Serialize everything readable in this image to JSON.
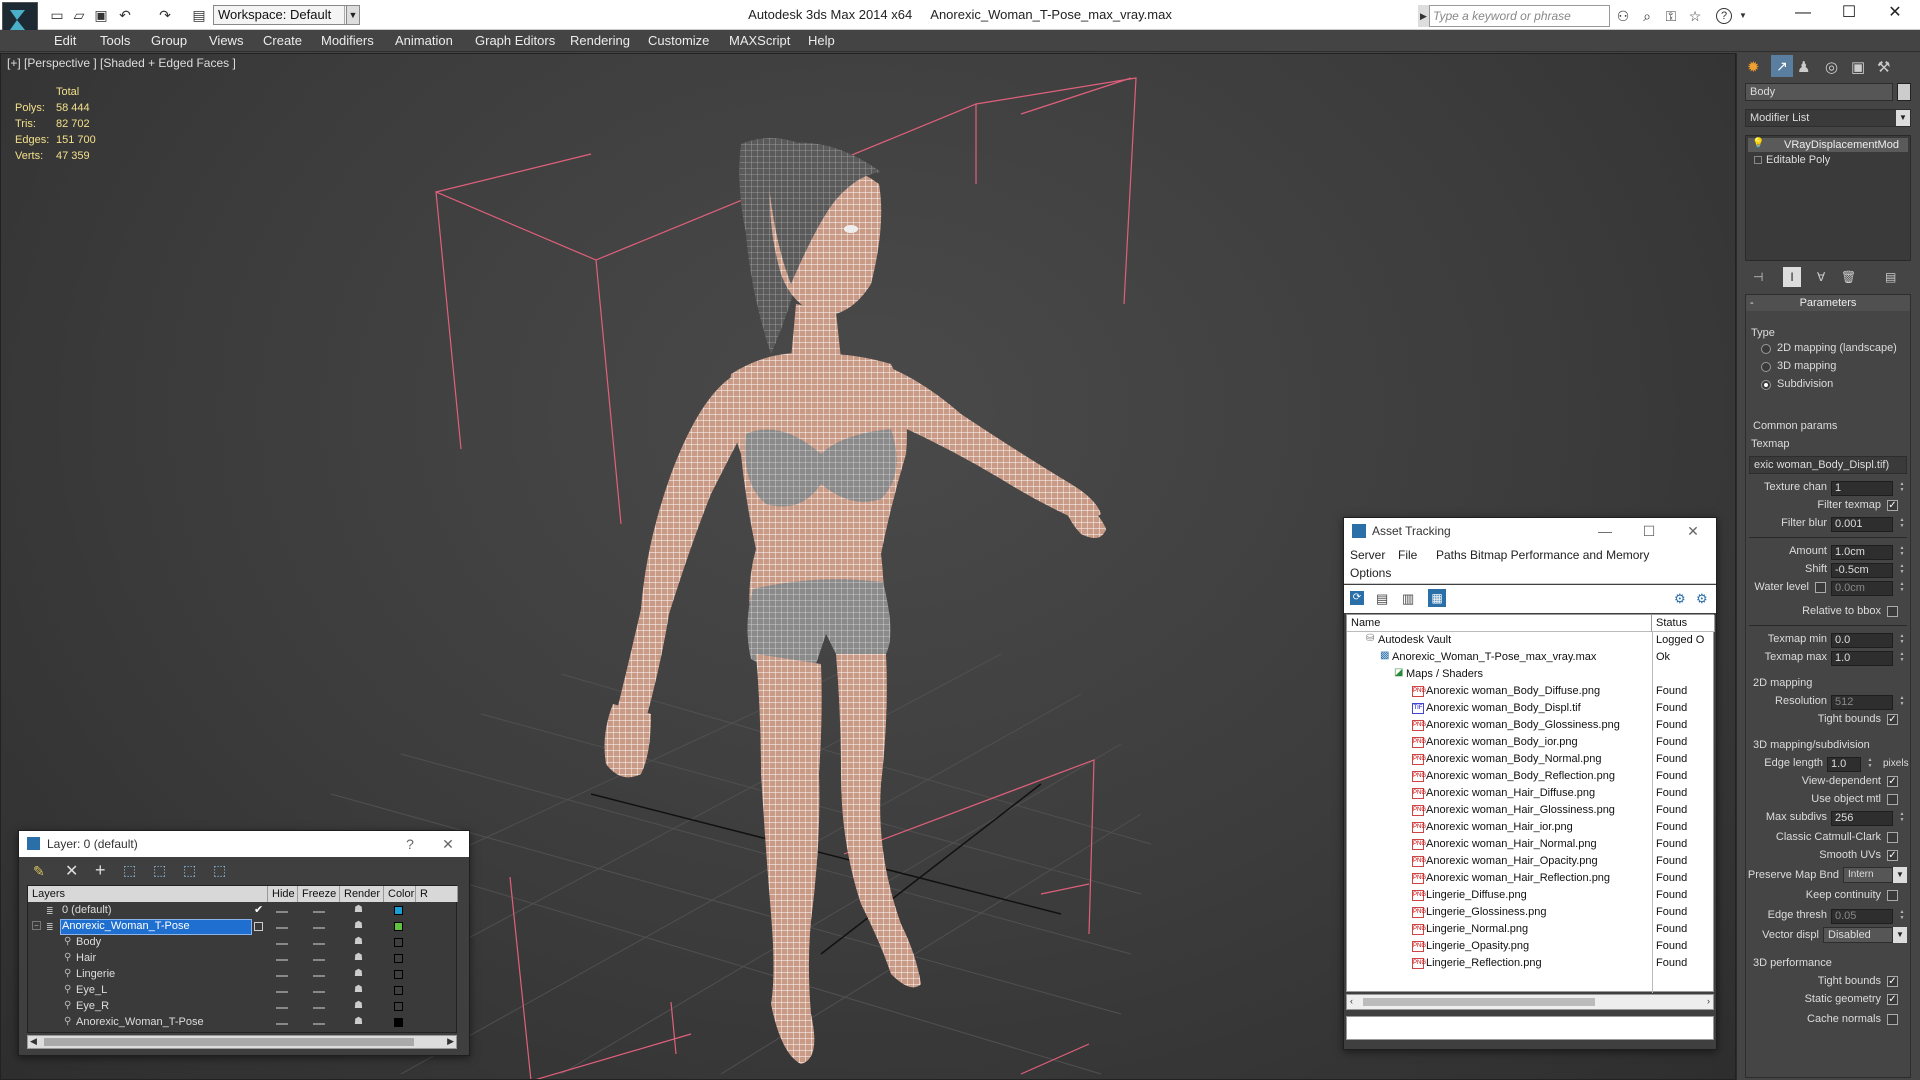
{
  "titlebar": {
    "workspace": "Workspace: Default",
    "app_title": "Autodesk 3ds Max  2014 x64",
    "file_title": "Anorexic_Woman_T-Pose_max_vray.max",
    "search_placeholder": "Type a keyword or phrase"
  },
  "menu": [
    "Edit",
    "Tools",
    "Group",
    "Views",
    "Create",
    "Modifiers",
    "Animation",
    "Graph Editors",
    "Rendering",
    "Customize",
    "MAXScript",
    "Help"
  ],
  "viewport": {
    "label": "[+] [Perspective ] [Shaded + Edged Faces ]",
    "stats_header": "Total",
    "stats": [
      {
        "label": "Polys:",
        "value": "58 444"
      },
      {
        "label": "Tris:",
        "value": "82 702"
      },
      {
        "label": "Edges:",
        "value": "151 700"
      },
      {
        "label": "Verts:",
        "value": "47 359"
      }
    ]
  },
  "layer_window": {
    "title": "Layer: 0 (default)",
    "help": "?",
    "close": "✕",
    "columns": [
      "Layers",
      "Hide",
      "Freeze",
      "Render",
      "Color",
      "R"
    ],
    "rows": [
      {
        "name": "0 (default)",
        "color": "#1a9ed6"
      },
      {
        "name": "Anorexic_Woman_T-Pose",
        "color": "#5fc33d"
      },
      {
        "name": "Body",
        "color": "#3f3f3f"
      },
      {
        "name": "Hair",
        "color": "#3f3f3f"
      },
      {
        "name": "Lingerie",
        "color": "#3f3f3f"
      },
      {
        "name": "Eye_L",
        "color": "#3f3f3f"
      },
      {
        "name": "Eye_R",
        "color": "#3f3f3f"
      },
      {
        "name": "Anorexic_Woman_T-Pose",
        "color": "#000000"
      }
    ]
  },
  "asset_window": {
    "title": "Asset Tracking",
    "menu": [
      "Server",
      "File",
      "Paths",
      "Bitmap Performance and Memory",
      "Options"
    ],
    "columns": [
      "Name",
      "Status"
    ],
    "vault": {
      "name": "Autodesk Vault",
      "status": "Logged O"
    },
    "file": {
      "name": "Anorexic_Woman_T-Pose_max_vray.max",
      "status": "Ok"
    },
    "group": "Maps / Shaders",
    "maps": [
      {
        "name": "Anorexic woman_Body_Diffuse.png",
        "type": "png",
        "status": "Found"
      },
      {
        "name": "Anorexic woman_Body_Displ.tif",
        "type": "tif",
        "status": "Found"
      },
      {
        "name": "Anorexic woman_Body_Glossiness.png",
        "type": "png",
        "status": "Found"
      },
      {
        "name": "Anorexic woman_Body_ior.png",
        "type": "png",
        "status": "Found"
      },
      {
        "name": "Anorexic woman_Body_Normal.png",
        "type": "png",
        "status": "Found"
      },
      {
        "name": "Anorexic woman_Body_Reflection.png",
        "type": "png",
        "status": "Found"
      },
      {
        "name": "Anorexic woman_Hair_Diffuse.png",
        "type": "png",
        "status": "Found"
      },
      {
        "name": "Anorexic woman_Hair_Glossiness.png",
        "type": "png",
        "status": "Found"
      },
      {
        "name": "Anorexic woman_Hair_ior.png",
        "type": "png",
        "status": "Found"
      },
      {
        "name": "Anorexic woman_Hair_Normal.png",
        "type": "png",
        "status": "Found"
      },
      {
        "name": "Anorexic woman_Hair_Opacity.png",
        "type": "png",
        "status": "Found"
      },
      {
        "name": "Anorexic woman_Hair_Reflection.png",
        "type": "png",
        "status": "Found"
      },
      {
        "name": "Lingerie_Diffuse.png",
        "type": "png",
        "status": "Found"
      },
      {
        "name": "Lingerie_Glossiness.png",
        "type": "png",
        "status": "Found"
      },
      {
        "name": "Lingerie_Normal.png",
        "type": "png",
        "status": "Found"
      },
      {
        "name": "Lingerie_Opasity.png",
        "type": "png",
        "status": "Found"
      },
      {
        "name": "Lingerie_Reflection.png",
        "type": "png",
        "status": "Found"
      }
    ]
  },
  "cmdpanel": {
    "object_name": "Body",
    "modifier_list": "Modifier List",
    "stack": [
      "VRayDisplacementMod",
      "Editable Poly"
    ],
    "rollout_title": "Parameters",
    "type_label": "Type",
    "type_options": [
      "2D mapping (landscape)",
      "3D mapping",
      "Subdivision"
    ],
    "common_params": "Common params",
    "texmap_label": "Texmap",
    "texmap_value": "exic woman_Body_Displ.tif)",
    "texture_chan_label": "Texture chan",
    "texture_chan": "1",
    "filter_texmap": "Filter texmap",
    "filter_blur_label": "Filter blur",
    "filter_blur": "0.001",
    "amount_label": "Amount",
    "amount": "1.0cm",
    "shift_label": "Shift",
    "shift": "-0.5cm",
    "water_level_label": "Water level",
    "water_level": "0.0cm",
    "relative_bbox": "Relative to bbox",
    "texmap_min_label": "Texmap min",
    "texmap_min": "0.0",
    "texmap_max_label": "Texmap max",
    "texmap_max": "1.0",
    "mapping2d": "2D mapping",
    "resolution_label": "Resolution",
    "resolution": "512",
    "tight_bounds": "Tight bounds",
    "mapping3d": "3D mapping/subdivision",
    "edge_length_label": "Edge length",
    "edge_length": "1.0",
    "pixels": "pixels",
    "view_dependent": "View-dependent",
    "use_object_mtl": "Use object mtl",
    "max_subdivs_label": "Max subdivs",
    "max_subdivs": "256",
    "classic_cc": "Classic Catmull-Clark",
    "smooth_uvs": "Smooth UVs",
    "preserve_map_label": "Preserve Map Bnd",
    "preserve_map": "Intern",
    "keep_continuity": "Keep continuity",
    "edge_thresh_label": "Edge thresh",
    "edge_thresh": "0.05",
    "vector_displ_label": "Vector displ",
    "vector_displ": "Disabled",
    "perf": "3D performance",
    "tight_bounds2": "Tight bounds",
    "static_geometry": "Static geometry",
    "cache_normals": "Cache normals"
  }
}
